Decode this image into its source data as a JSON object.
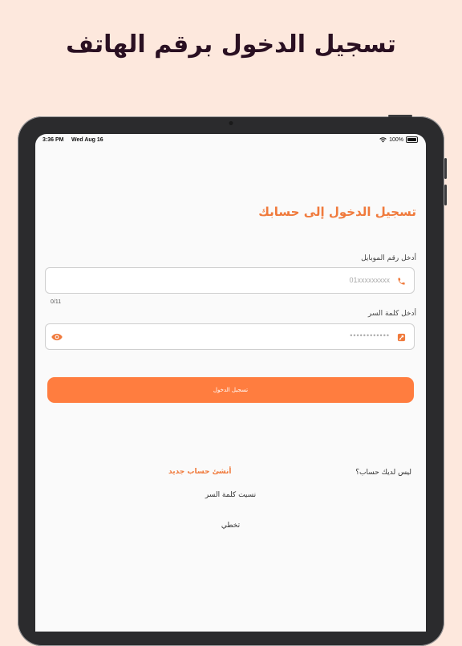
{
  "headline": "تسجيل الدخول برقم الهاتف",
  "status_bar": {
    "time": "3:36 PM",
    "date": "Wed Aug 16",
    "battery": "100%"
  },
  "login": {
    "title": "تسجيل الدخول إلى حسابك",
    "phone_label": "أدخل رقم الموبايل",
    "phone_placeholder": "01xxxxxxxxx",
    "phone_counter": "0/11",
    "password_label": "أدخل كلمة السر",
    "password_placeholder": "••••••••••••",
    "submit_label": "تسجيل الدخول",
    "no_account_text": "ليس لديك حساب؟",
    "create_account_label": "أنشئ حساب جديد",
    "forgot_password_label": "نسيت كلمة السر",
    "skip_label": "تخطي"
  },
  "colors": {
    "accent": "#ff7d3f",
    "title": "#f07a3c",
    "background": "#fde8dd"
  },
  "icons": {
    "phone": "phone-icon",
    "password": "key-icon",
    "visibility": "eye-icon"
  }
}
